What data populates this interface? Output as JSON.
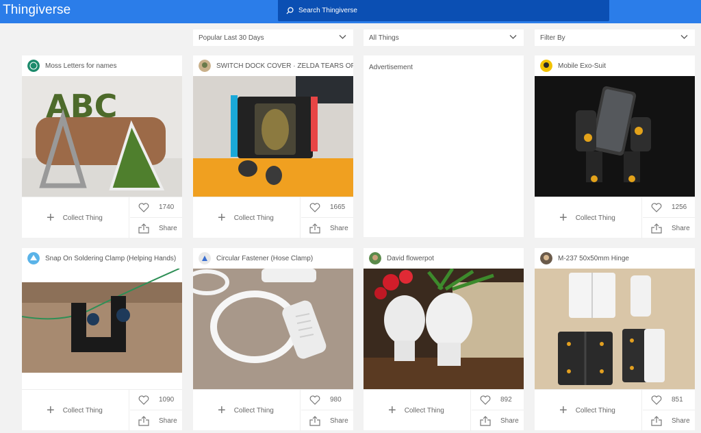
{
  "header": {
    "logo": "Thingiverse",
    "search_placeholder": "Search Thingiverse"
  },
  "filters": {
    "sort": "Popular Last 30 Days",
    "category": "All Things",
    "filter": "Filter By"
  },
  "advertisement": "Advertisement",
  "actions": {
    "collect": "Collect Thing",
    "share": "Share"
  },
  "cards": [
    {
      "title": "Moss Letters for names",
      "likes": "1740"
    },
    {
      "title": "SWITCH DOCK COVER · ZELDA TEARS OF T...",
      "likes": "1665"
    },
    {
      "title": "Mobile Exo-Suit",
      "likes": "1256"
    },
    {
      "title": "Snap On Soldering Clamp (Helping Hands)",
      "likes": "1090"
    },
    {
      "title": "Circular Fastener (Hose Clamp)",
      "likes": "980"
    },
    {
      "title": "David flowerpot",
      "likes": "892"
    },
    {
      "title": "M-237 50x50mm Hinge",
      "likes": "851"
    }
  ]
}
